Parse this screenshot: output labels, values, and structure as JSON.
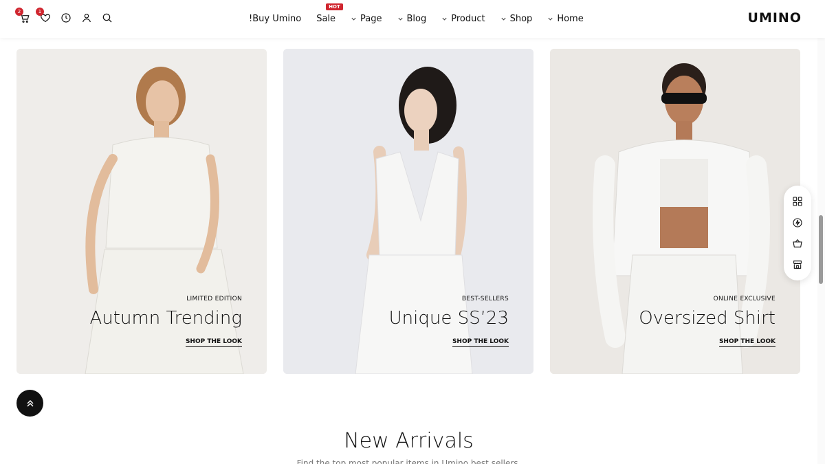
{
  "header": {
    "badges": {
      "cart": "2",
      "wishlist": "1"
    },
    "nav": [
      {
        "label": "!Buy Umino",
        "has_chevron": false
      },
      {
        "label": "Sale",
        "has_chevron": false,
        "tag": "HOT"
      },
      {
        "label": "Page",
        "has_chevron": true
      },
      {
        "label": "Blog",
        "has_chevron": true
      },
      {
        "label": "Product",
        "has_chevron": true
      },
      {
        "label": "Shop",
        "has_chevron": true
      },
      {
        "label": "Home",
        "has_chevron": true
      }
    ],
    "logo": "UMINO"
  },
  "cards": [
    {
      "subtitle": "LIMITED EDITION",
      "title": "Autumn Trending",
      "link": "SHOP THE LOOK"
    },
    {
      "subtitle": "BEST-SELLERS",
      "title": "Unique SS’23",
      "link": "SHOP THE LOOK"
    },
    {
      "subtitle": "ONLINE EXCLUSIVE",
      "title": "Oversized Shirt",
      "link": "SHOP THE LOOK"
    }
  ],
  "section": {
    "title": "New Arrivals",
    "subtitle": "Find the top most popular items in Umino best sellers."
  },
  "icons": {
    "header": [
      "cart-icon",
      "heart-icon",
      "clock-icon",
      "user-icon",
      "search-icon"
    ],
    "sidebar": [
      "grid-icon",
      "flash-icon",
      "basket-icon",
      "store-icon"
    ],
    "backtop": "double-chevron-up-icon"
  },
  "colors": {
    "accent": "#d0262f",
    "card1_bg": "#efedea",
    "card2_bg": "#e9eaee",
    "card3_bg": "#ebe8e4"
  }
}
